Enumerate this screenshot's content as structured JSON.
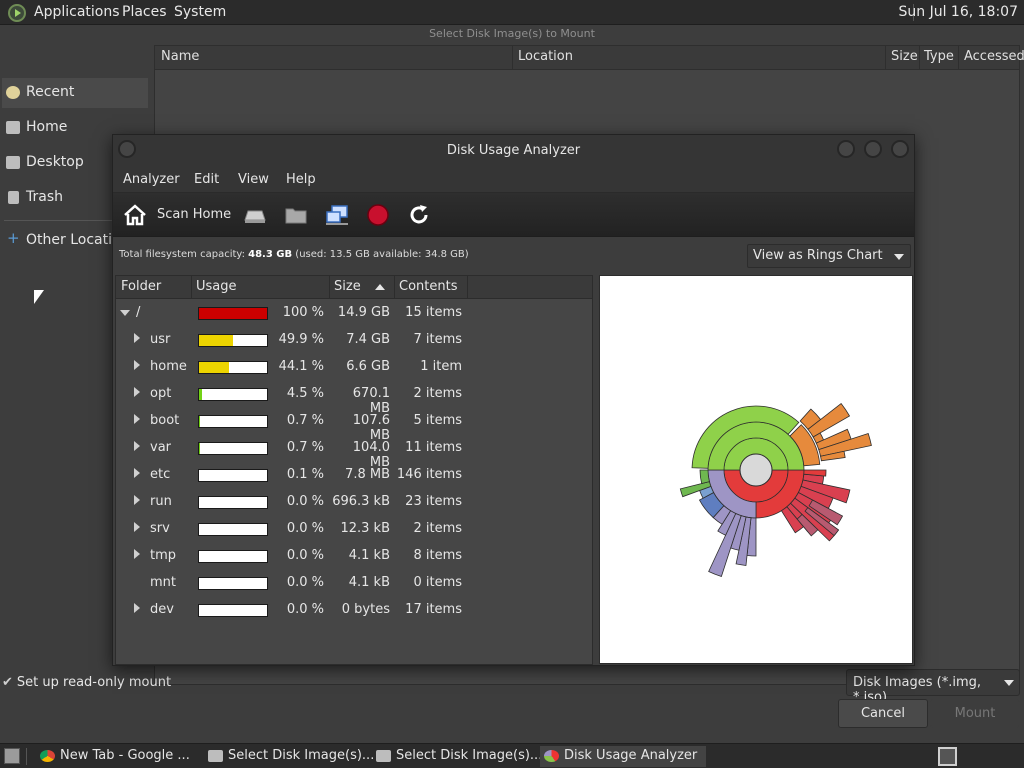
{
  "top_panel": {
    "menus": [
      "Applications",
      "Places",
      "System"
    ],
    "clock": "Sun Jul 16, 18:07"
  },
  "chooser": {
    "title": "Select Disk Image(s) to Mount",
    "places": [
      {
        "label": "Recent",
        "icon": "clock-icon"
      },
      {
        "label": "Home",
        "icon": "home-icon"
      },
      {
        "label": "Desktop",
        "icon": "desktop-icon"
      },
      {
        "label": "Trash",
        "icon": "trash-icon"
      }
    ],
    "other_locations": "Other Locations",
    "columns": [
      "Name",
      "Location",
      "Size",
      "Type",
      "Accessed"
    ],
    "readonly_label": "Set up read-only mount",
    "filter": "Disk Images (*.img, *.iso)",
    "cancel": "Cancel",
    "mount": "Mount"
  },
  "dua": {
    "title": "Disk Usage Analyzer",
    "menus": [
      "Analyzer",
      "Edit",
      "View",
      "Help"
    ],
    "scan_home": "Scan Home",
    "capacity_prefix": "Total filesystem capacity: ",
    "capacity_total": "48.3 GB",
    "capacity_detail": " (used: 13.5 GB available: 34.8 GB)",
    "view_mode": "View as Rings Chart",
    "columns": [
      "Folder",
      "Usage",
      "Size",
      "Contents"
    ],
    "rows": [
      {
        "name": "/",
        "pct": "100 %",
        "size": "14.9 GB",
        "contents": "15 items",
        "usage": 100,
        "color": "#cc0000",
        "expandable": true,
        "open": true,
        "level": 0
      },
      {
        "name": "usr",
        "pct": "49.9 %",
        "size": "7.4 GB",
        "contents": "7 items",
        "usage": 49.9,
        "color": "#edd400",
        "expandable": true,
        "open": false,
        "level": 1
      },
      {
        "name": "home",
        "pct": "44.1 %",
        "size": "6.6 GB",
        "contents": "1 item",
        "usage": 44.1,
        "color": "#edd400",
        "expandable": true,
        "open": false,
        "level": 1
      },
      {
        "name": "opt",
        "pct": "4.5 %",
        "size": "670.1 MB",
        "contents": "2 items",
        "usage": 4.5,
        "color": "#73d216",
        "expandable": true,
        "open": false,
        "level": 1
      },
      {
        "name": "boot",
        "pct": "0.7 %",
        "size": "107.6 MB",
        "contents": "5 items",
        "usage": 0.7,
        "color": "#73d216",
        "expandable": true,
        "open": false,
        "level": 1
      },
      {
        "name": "var",
        "pct": "0.7 %",
        "size": "104.0 MB",
        "contents": "11 items",
        "usage": 0.7,
        "color": "#73d216",
        "expandable": true,
        "open": false,
        "level": 1
      },
      {
        "name": "etc",
        "pct": "0.1 %",
        "size": "7.8 MB",
        "contents": "146 items",
        "usage": 0.1,
        "color": "#73d216",
        "expandable": true,
        "open": false,
        "level": 1
      },
      {
        "name": "run",
        "pct": "0.0 %",
        "size": "696.3 kB",
        "contents": "23 items",
        "usage": 0,
        "color": "#73d216",
        "expandable": true,
        "open": false,
        "level": 1
      },
      {
        "name": "srv",
        "pct": "0.0 %",
        "size": "12.3 kB",
        "contents": "2 items",
        "usage": 0,
        "color": "#73d216",
        "expandable": true,
        "open": false,
        "level": 1
      },
      {
        "name": "tmp",
        "pct": "0.0 %",
        "size": "4.1 kB",
        "contents": "8 items",
        "usage": 0,
        "color": "#73d216",
        "expandable": true,
        "open": false,
        "level": 1
      },
      {
        "name": "mnt",
        "pct": "0.0 %",
        "size": "4.1 kB",
        "contents": "0 items",
        "usage": 0,
        "color": "#73d216",
        "expandable": false,
        "open": false,
        "level": 1
      },
      {
        "name": "dev",
        "pct": "0.0 %",
        "size": "0 bytes",
        "contents": "17 items",
        "usage": 0,
        "color": "#73d216",
        "expandable": true,
        "open": false,
        "level": 1
      }
    ]
  },
  "taskbar": {
    "tasks": [
      {
        "label": "New Tab - Google ...",
        "icon": "chrome-icon"
      },
      {
        "label": "Select Disk Image(s)...",
        "icon": "window-icon"
      },
      {
        "label": "Select Disk Image(s)...",
        "icon": "window-icon"
      },
      {
        "label": "Disk Usage Analyzer",
        "icon": "disk-usage-icon"
      }
    ]
  }
}
